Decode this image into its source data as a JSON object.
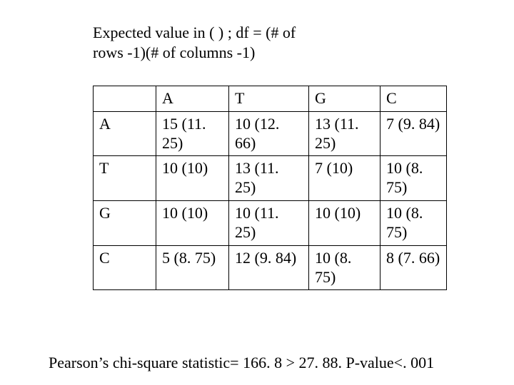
{
  "caption_line1": "Expected value in  (    ) ; df = (# of",
  "caption_line2": "rows -1)(# of columns -1)",
  "header": {
    "blank": "",
    "colA": "A",
    "colT": "T",
    "colG": "G",
    "colC": "C"
  },
  "rows": {
    "A": {
      "label": "A",
      "cA": "15 (11. 25)",
      "cT": "10 (12. 66)",
      "cG": "13 (11. 25)",
      "cC": "7 (9. 84)"
    },
    "T": {
      "label": "T",
      "cA": "10 (10)",
      "cT": "13 (11. 25)",
      "cG": " 7  (10)",
      "cC": "10 (8. 75)"
    },
    "G": {
      "label": "G",
      "cA": "10 (10)",
      "cT": "10 (11. 25)",
      "cG": "10 (10)",
      "cC": "10 (8. 75)"
    },
    "C": {
      "label": "C",
      "cA": "5 (8. 75)",
      "cT": "12 (9. 84)",
      "cG": "10 (8. 75)",
      "cC": "8 (7. 66)"
    }
  },
  "footer": "Pearson’s chi-square statistic= 166. 8 > 27. 88. P-value<. 001",
  "chart_data": {
    "type": "table",
    "title": "Observed (Expected) dinucleotide counts",
    "row_labels": [
      "A",
      "T",
      "G",
      "C"
    ],
    "col_labels": [
      "A",
      "T",
      "G",
      "C"
    ],
    "observed": [
      [
        15,
        10,
        13,
        7
      ],
      [
        10,
        13,
        7,
        10
      ],
      [
        10,
        10,
        10,
        10
      ],
      [
        5,
        12,
        10,
        8
      ]
    ],
    "expected": [
      [
        11.25,
        12.66,
        11.25,
        9.84
      ],
      [
        10,
        11.25,
        10,
        8.75
      ],
      [
        10,
        11.25,
        10,
        8.75
      ],
      [
        8.75,
        9.84,
        8.75,
        7.66
      ]
    ],
    "df_formula": "(# of rows - 1)(# of columns - 1)",
    "chi_square": 166.8,
    "critical_value": 27.88,
    "p_value": "< .001"
  }
}
